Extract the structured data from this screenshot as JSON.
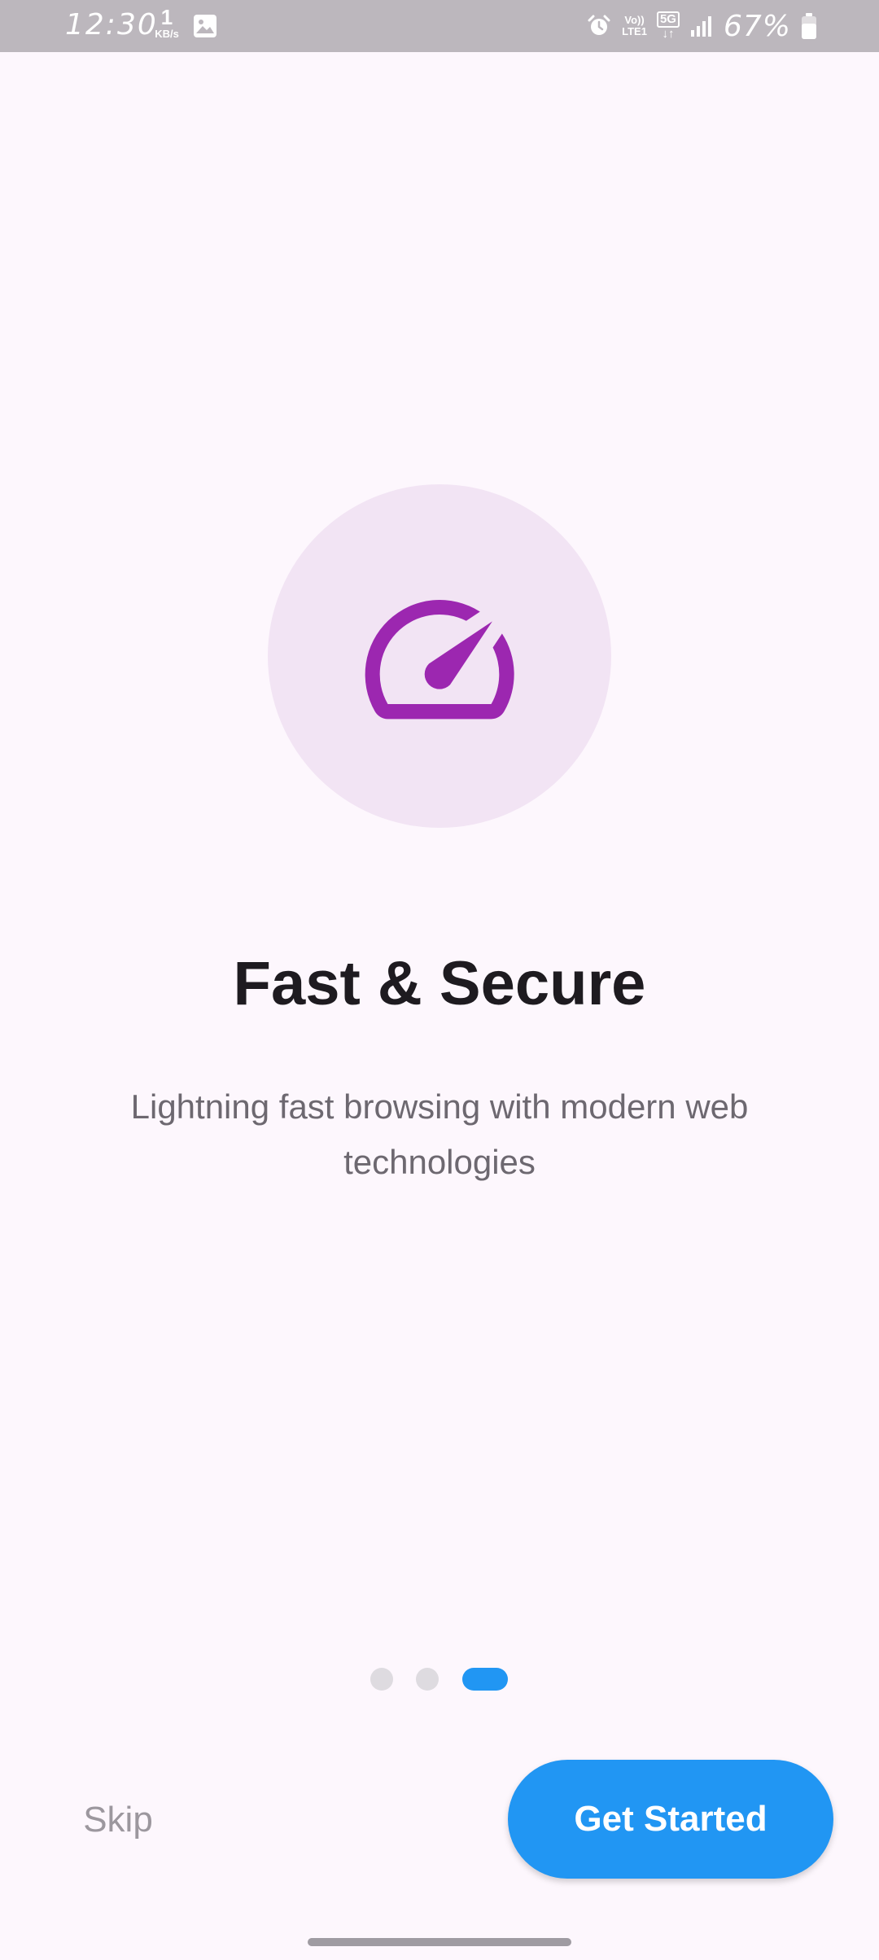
{
  "status_bar": {
    "time": "12:30",
    "net_speed": "1",
    "net_speed_unit": "KB/s",
    "volte": "Vo))",
    "lte": "LTE1",
    "network": "5G",
    "battery": "67%"
  },
  "onboarding": {
    "icon": "speed-icon",
    "icon_color": "#9c27b0",
    "icon_bg": "#f2e4f4",
    "title": "Fast & Secure",
    "subtitle": "Lightning fast browsing with modern web technologies",
    "page_count": 3,
    "current_page": 3
  },
  "actions": {
    "skip_label": "Skip",
    "primary_label": "Get Started",
    "primary_color": "#2196f3"
  }
}
